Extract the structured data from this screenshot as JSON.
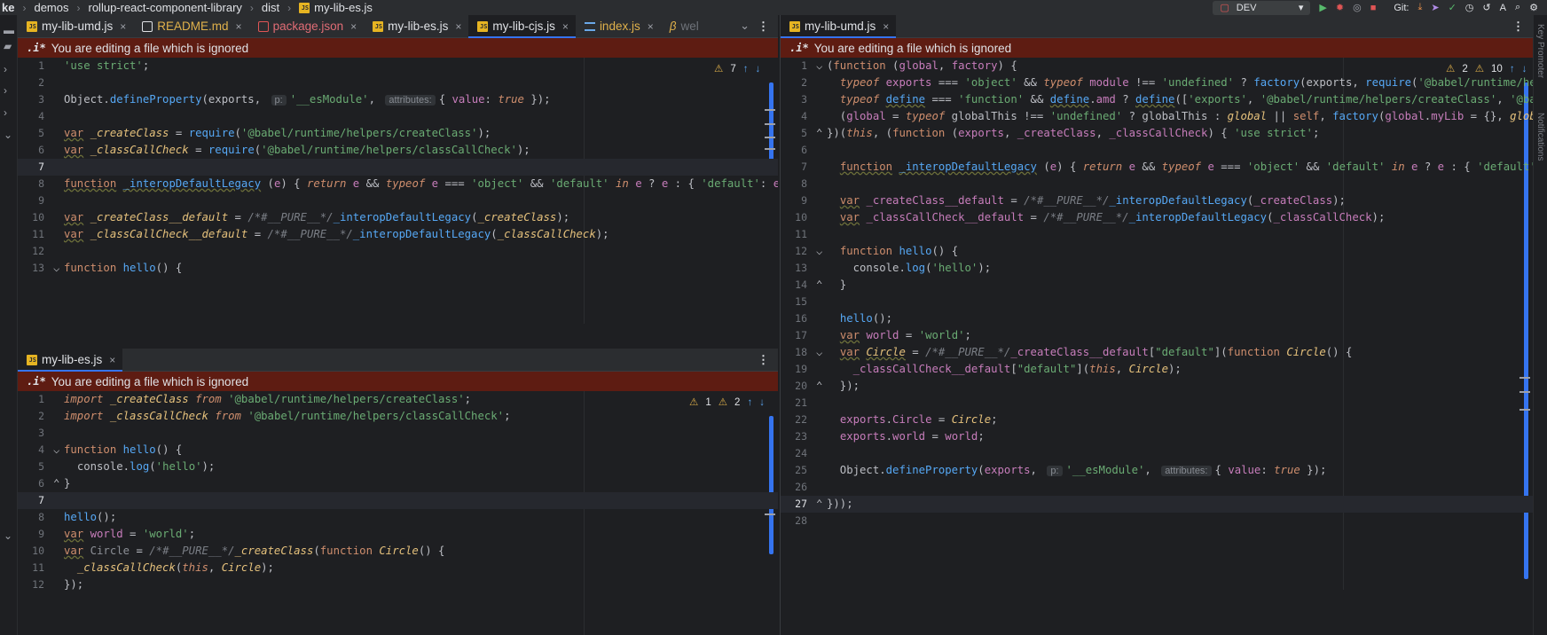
{
  "topbar": {
    "project_cut": "ke",
    "breadcrumbs": [
      "demos",
      "rollup-react-component-library",
      "dist",
      "my-lib-es.js"
    ],
    "run_config": "DEV",
    "git_label": "Git:"
  },
  "left_tabs": [
    {
      "label": "my-lib-umd.js",
      "icon": "js-file-icon",
      "color": "#dfe1e5"
    },
    {
      "label": "README.md",
      "icon": "markdown-file-icon",
      "color": "#e0b14b"
    },
    {
      "label": "package.json",
      "icon": "package-json-icon",
      "color": "#e06c75"
    },
    {
      "label": "my-lib-es.js",
      "icon": "js-file-icon",
      "color": "#dfe1e5"
    },
    {
      "label": "my-lib-cjs.js",
      "icon": "js-file-icon",
      "color": "#dfe1e5",
      "active": true
    },
    {
      "label": "index.js",
      "icon": "index-file-icon",
      "color": "#e0b14b"
    },
    {
      "label": "wel",
      "icon": "babel-file-icon",
      "color": "#6f737a"
    }
  ],
  "bottom_tab": {
    "label": "my-lib-es.js"
  },
  "right_tab": {
    "label": "my-lib-umd.js"
  },
  "banner": {
    "prefix": ".i*",
    "text": "You are editing a file which is ignored"
  },
  "cjs_inspections": {
    "warnings": "7"
  },
  "es_inspections": {
    "errors": "1",
    "warnings": "2"
  },
  "umd_inspections": {
    "warnings": "2",
    "weak": "10"
  },
  "hints": {
    "p": "p:",
    "attributes": "attributes:"
  },
  "colors": {
    "accent": "#3574f0",
    "banner_bg": "#5e1c12",
    "editor_bg": "#1e1f22"
  }
}
